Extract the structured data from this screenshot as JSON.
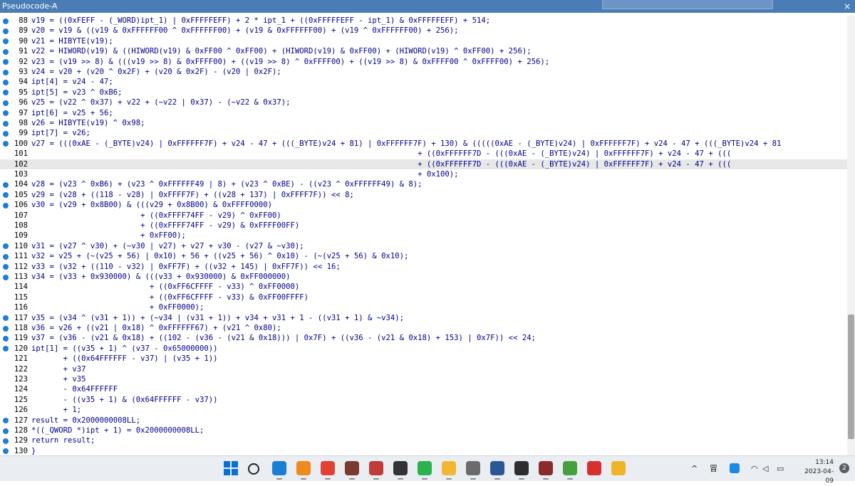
{
  "window": {
    "title": "Pseudocode-A",
    "close_glyph": "×"
  },
  "code_lines": [
    {
      "n": "88",
      "bp": true,
      "text": "v19 = ((0xFEFF - (_WORD)ipt_1) | 0xFFFFFEFF) + 2 * ipt_1 + ((0xFFFFFEFF - ipt_1) & 0xFFFFFEFF) + 514;"
    },
    {
      "n": "89",
      "bp": true,
      "text": "v20 = v19 & ((v19 & 0xFFFFFF00 ^ 0xFFFFFF00) + (v19 & 0xFFFFFF00) + (v19 ^ 0xFFFFFF00) + 256);"
    },
    {
      "n": "90",
      "bp": true,
      "text": "v21 = HIBYTE(v19);"
    },
    {
      "n": "91",
      "bp": true,
      "text": "v22 = HIWORD(v19) & ((HIWORD(v19) & 0xFF00 ^ 0xFF00) + (HIWORD(v19) & 0xFF00) + (HIWORD(v19) ^ 0xFF00) + 256);"
    },
    {
      "n": "92",
      "bp": true,
      "text": "v23 = (v19 >> 8) & (((v19 >> 8) & 0xFFFF00) + ((v19 >> 8) ^ 0xFFFF00) + ((v19 >> 8) & 0xFFFF00 ^ 0xFFFF00) + 256);"
    },
    {
      "n": "93",
      "bp": true,
      "text": "v24 = v20 + (v20 ^ 0x2F) + (v20 & 0x2F) - (v20 | 0x2F);"
    },
    {
      "n": "94",
      "bp": true,
      "text": "ipt[4] = v24 - 47;"
    },
    {
      "n": "95",
      "bp": true,
      "text": "ipt[5] = v23 ^ 0xB6;"
    },
    {
      "n": "96",
      "bp": true,
      "text": "v25 = (v22 ^ 0x37) + v22 + (~v22 | 0x37) - (~v22 & 0x37);"
    },
    {
      "n": "97",
      "bp": true,
      "text": "ipt[6] = v25 + 56;"
    },
    {
      "n": "98",
      "bp": true,
      "text": "v26 = HIBYTE(v19) ^ 0x98;"
    },
    {
      "n": "99",
      "bp": true,
      "text": "ipt[7] = v26;"
    },
    {
      "n": "100",
      "bp": true,
      "text": "v27 = (((0xAE - (_BYTE)v24) | 0xFFFFFF7F) + v24 - 47 + (((_BYTE)v24 + 81) | 0xFFFFFF7F) + 130) & (((((0xAE - (_BYTE)v24) | 0xFFFFFF7F) + v24 - 47 + (((_BYTE)v24 + 81"
    },
    {
      "n": "101",
      "bp": false,
      "text": "                                                                                     + ((0xFFFFFF7D - (((0xAE - (_BYTE)v24) | 0xFFFFFF7F) + v24 - 47 + ((("
    },
    {
      "n": "102",
      "bp": false,
      "text": "                                                                                     + ((0xFFFFFF7D - (((0xAE - (_BYTE)v24) | 0xFFFFFF7F) + v24 - 47 + ((("
    },
    {
      "n": "103",
      "bp": false,
      "text": "                                                                                     + 0x100);"
    },
    {
      "n": "104",
      "bp": true,
      "text": "v28 = (v23 ^ 0xB6) + (v23 ^ 0xFFFFFF49 | 8) + (v23 ^ 0xBE) - ((v23 ^ 0xFFFFFF49) & 8);"
    },
    {
      "n": "105",
      "bp": true,
      "text": "v29 = (v28 + ((118 - v28) | 0xFFFF7F) + ((v28 + 137) | 0xFFFF7F)) << 8;"
    },
    {
      "n": "106",
      "bp": true,
      "text": "v30 = (v29 + 0x8B00) & (((v29 + 0x8B00) & 0xFFFF0000)"
    },
    {
      "n": "107",
      "bp": false,
      "text": "                        + ((0xFFFF74FF - v29) ^ 0xFF00)"
    },
    {
      "n": "108",
      "bp": false,
      "text": "                        + ((0xFFFF74FF - v29) & 0xFFFF00FF)"
    },
    {
      "n": "109",
      "bp": false,
      "text": "                        + 0xFF00);"
    },
    {
      "n": "110",
      "bp": true,
      "text": "v31 = (v27 ^ v30) + (~v30 | v27) + v27 + v30 - (v27 & ~v30);"
    },
    {
      "n": "111",
      "bp": true,
      "text": "v32 = v25 + (~(v25 + 56) | 0x10) + 56 + ((v25 + 56) ^ 0x10) - (~(v25 + 56) & 0x10);"
    },
    {
      "n": "112",
      "bp": true,
      "text": "v33 = (v32 + ((110 - v32) | 0xFF7F) + ((v32 + 145) | 0xFF7F)) << 16;"
    },
    {
      "n": "113",
      "bp": true,
      "text": "v34 = (v33 + 0x930000) & (((v33 + 0x930000) & 0xFF000000)"
    },
    {
      "n": "114",
      "bp": false,
      "text": "                          + ((0xFF6CFFFF - v33) ^ 0xFF0000)"
    },
    {
      "n": "115",
      "bp": false,
      "text": "                          + ((0xFF6CFFFF - v33) & 0xFF00FFFF)"
    },
    {
      "n": "116",
      "bp": false,
      "text": "                          + 0xFF0000);"
    },
    {
      "n": "117",
      "bp": true,
      "text": "v35 = (v34 ^ (v31 + 1)) + (~v34 | (v31 + 1)) + v34 + v31 + 1 - ((v31 + 1) & ~v34);"
    },
    {
      "n": "118",
      "bp": true,
      "text": "v36 = v26 + ((v21 | 0x18) ^ 0xFFFFFF67) + (v21 ^ 0x80);"
    },
    {
      "n": "119",
      "bp": true,
      "text": "v37 = (v36 - (v21 & 0x18) + ((102 - (v36 - (v21 & 0x18))) | 0x7F) + ((v36 - (v21 & 0x18) + 153) | 0x7F)) << 24;"
    },
    {
      "n": "120",
      "bp": true,
      "text": "ipt[1] = ((v35 + 1) ^ (v37 - 0x65000000))"
    },
    {
      "n": "121",
      "bp": false,
      "text": "       + ((0x64FFFFFF - v37) | (v35 + 1))"
    },
    {
      "n": "122",
      "bp": false,
      "text": "       + v37"
    },
    {
      "n": "123",
      "bp": false,
      "text": "       + v35"
    },
    {
      "n": "124",
      "bp": false,
      "text": "       - 0x64FFFFFF"
    },
    {
      "n": "125",
      "bp": false,
      "text": "       - ((v35 + 1) & (0x64FFFFFF - v37))"
    },
    {
      "n": "126",
      "bp": false,
      "text": "       + 1;"
    },
    {
      "n": "127",
      "bp": true,
      "text": "result = 0x2000000008LL;"
    },
    {
      "n": "128",
      "bp": true,
      "text": "*((_QWORD *)ipt + 1) = 0x2000000008LL;"
    },
    {
      "n": "129",
      "bp": true,
      "text": "return result;"
    },
    {
      "n": "130",
      "bp": true,
      "text": "}"
    }
  ],
  "highlighted_line": "102",
  "taskbar": {
    "apps": [
      {
        "name": "start-icon",
        "color": "#0a6fd6"
      },
      {
        "name": "search-icon",
        "color": "#222222"
      },
      {
        "name": "vscode-icon",
        "color": "#1a7fd4"
      },
      {
        "name": "app-orange-icon",
        "color": "#f08a1c"
      },
      {
        "name": "chrome-icon",
        "color": "#e34133"
      },
      {
        "name": "avatar-app-icon",
        "color": "#7a3b2e"
      },
      {
        "name": "ida-icon",
        "color": "#c23b3b"
      },
      {
        "name": "copy-app-icon",
        "color": "#333333"
      },
      {
        "name": "wechat-icon",
        "color": "#2bb24c"
      },
      {
        "name": "folder-icon",
        "color": "#f2b632"
      },
      {
        "name": "gear-app-icon",
        "color": "#6b6b6b"
      },
      {
        "name": "word-icon",
        "color": "#2b5797"
      },
      {
        "name": "terminal-icon",
        "color": "#2d2d2d"
      },
      {
        "name": "ida-dark-icon",
        "color": "#8a2a2a"
      },
      {
        "name": "gear-green-icon",
        "color": "#45a13e"
      },
      {
        "name": "netease-icon",
        "color": "#d6302f"
      },
      {
        "name": "ball-app-icon",
        "color": "#f0b429"
      }
    ],
    "tray": {
      "chevron": "^",
      "ime": "冒",
      "clock_time": "13:14",
      "clock_date": "2023-04-09",
      "notification_count": "2"
    }
  }
}
